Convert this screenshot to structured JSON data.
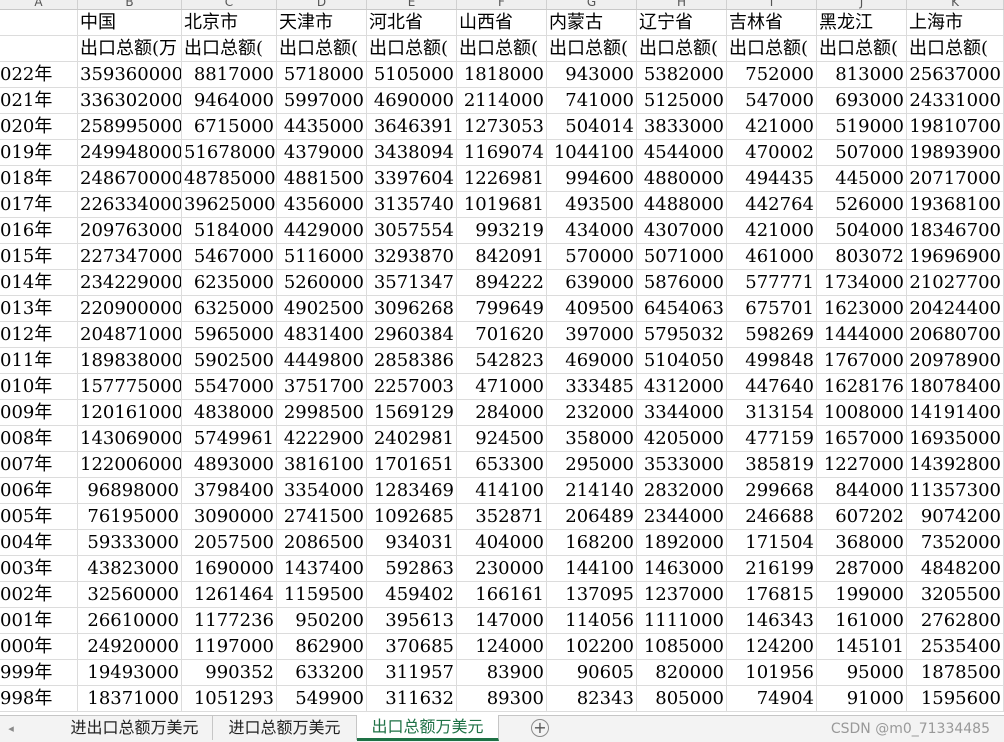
{
  "spreadsheet": {
    "column_letters": [
      "A",
      "B",
      "C",
      "D",
      "E",
      "F",
      "G",
      "H",
      "I",
      "J",
      "K"
    ],
    "region_names": [
      "中国",
      "北京市",
      "天津市",
      "河北省",
      "山西省",
      "内蒙古",
      "辽宁省",
      "吉林省",
      "黑龙江",
      "上海市"
    ],
    "metric_labels": [
      "出口总额(万",
      "出口总额(",
      "出口总额(",
      "出口总额(",
      "出口总额(",
      "出口总额(",
      "出口总额(",
      "出口总额(",
      "出口总额(",
      "出口总额("
    ],
    "rows": [
      {
        "year": "022年",
        "values": [
          "359360000",
          "8817000",
          "5718000",
          "5105000",
          "1818000",
          "943000",
          "5382000",
          "752000",
          "813000",
          "25637000"
        ]
      },
      {
        "year": "021年",
        "values": [
          "336302000",
          "9464000",
          "5997000",
          "4690000",
          "2114000",
          "741000",
          "5125000",
          "547000",
          "693000",
          "24331000"
        ]
      },
      {
        "year": "020年",
        "values": [
          "258995000",
          "6715000",
          "4435000",
          "3646391",
          "1273053",
          "504014",
          "3833000",
          "421000",
          "519000",
          "19810700"
        ]
      },
      {
        "year": "019年",
        "values": [
          "249948000",
          "51678000",
          "4379000",
          "3438094",
          "1169074",
          "1044100",
          "4544000",
          "470002",
          "507000",
          "19893900"
        ]
      },
      {
        "year": "018年",
        "values": [
          "248670000",
          "48785000",
          "4881500",
          "3397604",
          "1226981",
          "994600",
          "4880000",
          "494435",
          "445000",
          "20717000"
        ]
      },
      {
        "year": "017年",
        "values": [
          "226334000",
          "39625000",
          "4356000",
          "3135740",
          "1019681",
          "493500",
          "4488000",
          "442764",
          "526000",
          "19368100"
        ]
      },
      {
        "year": "016年",
        "values": [
          "209763000",
          "5184000",
          "4429000",
          "3057554",
          "993219",
          "434000",
          "4307000",
          "421000",
          "504000",
          "18346700"
        ]
      },
      {
        "year": "015年",
        "values": [
          "227347000",
          "5467000",
          "5116000",
          "3293870",
          "842091",
          "570000",
          "5071000",
          "461000",
          "803072",
          "19696900"
        ]
      },
      {
        "year": "014年",
        "values": [
          "234229000",
          "6235000",
          "5260000",
          "3571347",
          "894222",
          "639000",
          "5876000",
          "577771",
          "1734000",
          "21027700"
        ]
      },
      {
        "year": "013年",
        "values": [
          "220900000",
          "6325000",
          "4902500",
          "3096268",
          "799649",
          "409500",
          "6454063",
          "675701",
          "1623000",
          "20424400"
        ]
      },
      {
        "year": "012年",
        "values": [
          "204871000",
          "5965000",
          "4831400",
          "2960384",
          "701620",
          "397000",
          "5795032",
          "598269",
          "1444000",
          "20680700"
        ]
      },
      {
        "year": "011年",
        "values": [
          "189838000",
          "5902500",
          "4449800",
          "2858386",
          "542823",
          "469000",
          "5104050",
          "499848",
          "1767000",
          "20978900"
        ]
      },
      {
        "year": "010年",
        "values": [
          "157775000",
          "5547000",
          "3751700",
          "2257003",
          "471000",
          "333485",
          "4312000",
          "447640",
          "1628176",
          "18078400"
        ]
      },
      {
        "year": "009年",
        "values": [
          "120161000",
          "4838000",
          "2998500",
          "1569129",
          "284000",
          "232000",
          "3344000",
          "313154",
          "1008000",
          "14191400"
        ]
      },
      {
        "year": "008年",
        "values": [
          "143069000",
          "5749961",
          "4222900",
          "2402981",
          "924500",
          "358000",
          "4205000",
          "477159",
          "1657000",
          "16935000"
        ]
      },
      {
        "year": "007年",
        "values": [
          "122006000",
          "4893000",
          "3816100",
          "1701651",
          "653300",
          "295000",
          "3533000",
          "385819",
          "1227000",
          "14392800"
        ]
      },
      {
        "year": "006年",
        "values": [
          "96898000",
          "3798400",
          "3354000",
          "1283469",
          "414100",
          "214140",
          "2832000",
          "299668",
          "844000",
          "11357300"
        ]
      },
      {
        "year": "005年",
        "values": [
          "76195000",
          "3090000",
          "2741500",
          "1092685",
          "352871",
          "206489",
          "2344000",
          "246688",
          "607202",
          "9074200"
        ]
      },
      {
        "year": "004年",
        "values": [
          "59333000",
          "2057500",
          "2086500",
          "934031",
          "404000",
          "168200",
          "1892000",
          "171504",
          "368000",
          "7352000"
        ]
      },
      {
        "year": "003年",
        "values": [
          "43823000",
          "1690000",
          "1437400",
          "592863",
          "230000",
          "144100",
          "1463000",
          "216199",
          "287000",
          "4848200"
        ]
      },
      {
        "year": "002年",
        "values": [
          "32560000",
          "1261464",
          "1159500",
          "459402",
          "166161",
          "137095",
          "1237000",
          "176815",
          "199000",
          "3205500"
        ]
      },
      {
        "year": "001年",
        "values": [
          "26610000",
          "1177236",
          "950200",
          "395613",
          "147000",
          "114056",
          "1111000",
          "146343",
          "161000",
          "2762800"
        ]
      },
      {
        "year": "000年",
        "values": [
          "24920000",
          "1197000",
          "862900",
          "370685",
          "124000",
          "102200",
          "1085000",
          "124200",
          "145101",
          "2535400"
        ]
      },
      {
        "year": "999年",
        "values": [
          "19493000",
          "990352",
          "633200",
          "311957",
          "83900",
          "90605",
          "820000",
          "101956",
          "95000",
          "1878500"
        ]
      },
      {
        "year": "998年",
        "values": [
          "18371000",
          "1051293",
          "549900",
          "311632",
          "89300",
          "82343",
          "805000",
          "74904",
          "91000",
          "1595600"
        ]
      }
    ]
  },
  "sheet_tabs": {
    "nav_left_icon": "triangle-left-icon",
    "tabs": [
      {
        "label": "进出口总额万美元",
        "active": false
      },
      {
        "label": "进口总额万美元",
        "active": false
      },
      {
        "label": "出口总额万美元",
        "active": true
      }
    ],
    "add_label": "+",
    "active_color": "#1e7145"
  },
  "watermark": "CSDN @m0_71334485"
}
